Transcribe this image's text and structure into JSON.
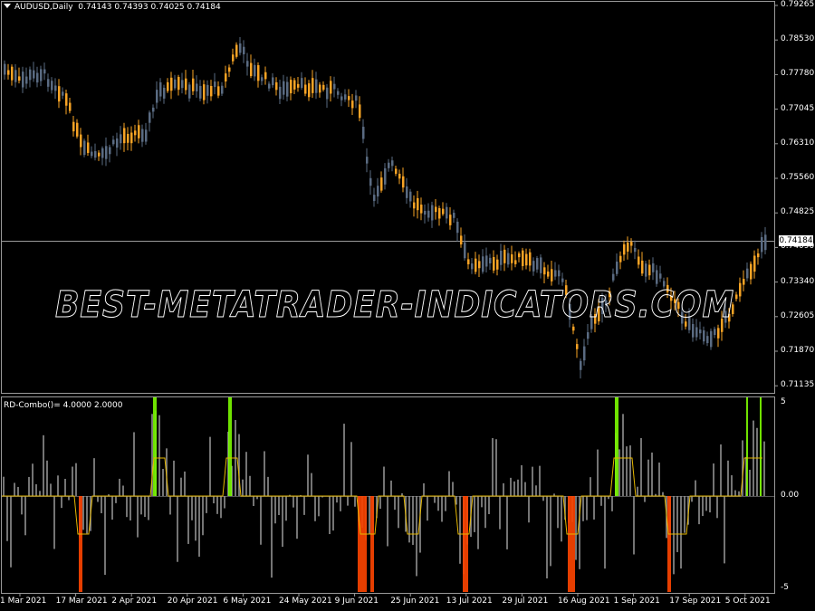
{
  "window": {
    "symbol_title": "AUDUSD,Daily",
    "ohlc": "0.74143 0.74393 0.74025 0.74184",
    "indicator_title": "RD-Combo()= ",
    "indicator_values": "4.0000 2.0000",
    "watermark": "BEST-METATRADER-INDICATORS.COM",
    "current_price": "0.74184"
  },
  "price_axis": {
    "labels": [
      "0.79265",
      "0.78530",
      "0.77780",
      "0.77045",
      "0.76310",
      "0.75560",
      "0.74825",
      "0.74090",
      "0.73340",
      "0.72605",
      "0.71870",
      "0.71135"
    ]
  },
  "indicator_axis": {
    "labels": [
      "5",
      "0.00",
      "-5"
    ]
  },
  "time_axis": {
    "labels": [
      "1 Mar 2021",
      "17 Mar 2021",
      "2 Apr 2021",
      "20 Apr 2021",
      "6 May 2021",
      "24 May 2021",
      "9 Jun 2021",
      "25 Jun 2021",
      "13 Jul 2021",
      "29 Jul 2021",
      "16 Aug 2021",
      "1 Sep 2021",
      "17 Sep 2021",
      "5 Oct 2021"
    ]
  },
  "colors": {
    "background": "#000000",
    "bull": "#f7a325",
    "bear": "#5a6b82",
    "histogram": "#9a9a9a",
    "histogram_up": "#7cfc00",
    "histogram_down": "#ff4500",
    "signal_line": "#e6b800",
    "grid": "#9a9a9a"
  }
}
